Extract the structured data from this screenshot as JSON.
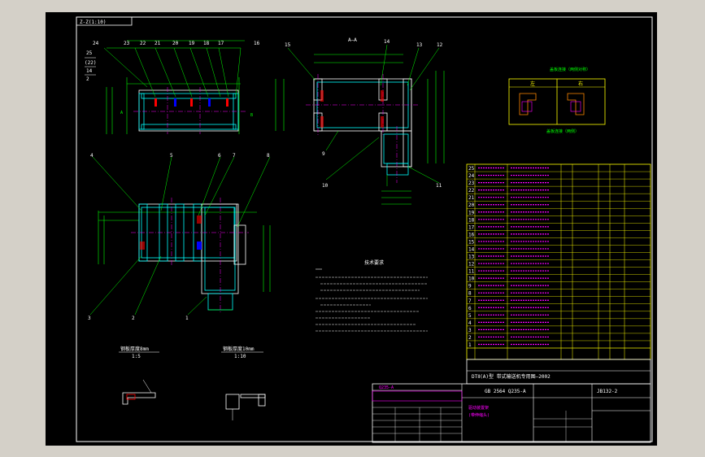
{
  "drawing": {
    "section_label": "Z-Z(1:10)",
    "section_aa": "A—A",
    "notes_title": "技术要求",
    "detail1_title": "钢板厚度8mm",
    "detail1_scale": "1:5",
    "detail2_title": "钢板厚度10mm",
    "detail2_scale": "1:10",
    "small_title": "盖板连接（两侧对称）",
    "small_caption": "盖板连接（两侧）",
    "small_left": "左",
    "small_right": "右",
    "title_main": "DTⅡ(A)型 带式输送机专用图—2002",
    "drawing_no": "JB132-2",
    "part_name": "驱动装置架",
    "part_sub": "(带伸缩头)",
    "material": "Q235-A",
    "standard": "GB 2564 Q235-A",
    "callouts_top": [
      "24",
      "23",
      "22",
      "21",
      "20",
      "19",
      "18",
      "17",
      "16"
    ],
    "callouts_left": [
      "25",
      "(22)",
      "14",
      "2"
    ],
    "callouts_section": [
      "15",
      "14",
      "13",
      "12",
      "9",
      "10",
      "11",
      "8"
    ],
    "callouts_plan": [
      "4",
      "5",
      "6",
      "7",
      "8",
      "3",
      "2",
      "1"
    ]
  },
  "bom": {
    "rows": [
      "25",
      "24",
      "23",
      "22",
      "21",
      "20",
      "19",
      "18",
      "17",
      "16",
      "15",
      "14",
      "13",
      "12",
      "11",
      "10",
      "9",
      "8",
      "7",
      "6",
      "5",
      "4",
      "3",
      "2",
      "1"
    ]
  },
  "colors": {
    "frame": "#ffffff",
    "part": "#00ffff",
    "center": "#ff00ff",
    "dim": "#00ff00",
    "text": "#ffff00",
    "hidden": "#ff0000"
  }
}
